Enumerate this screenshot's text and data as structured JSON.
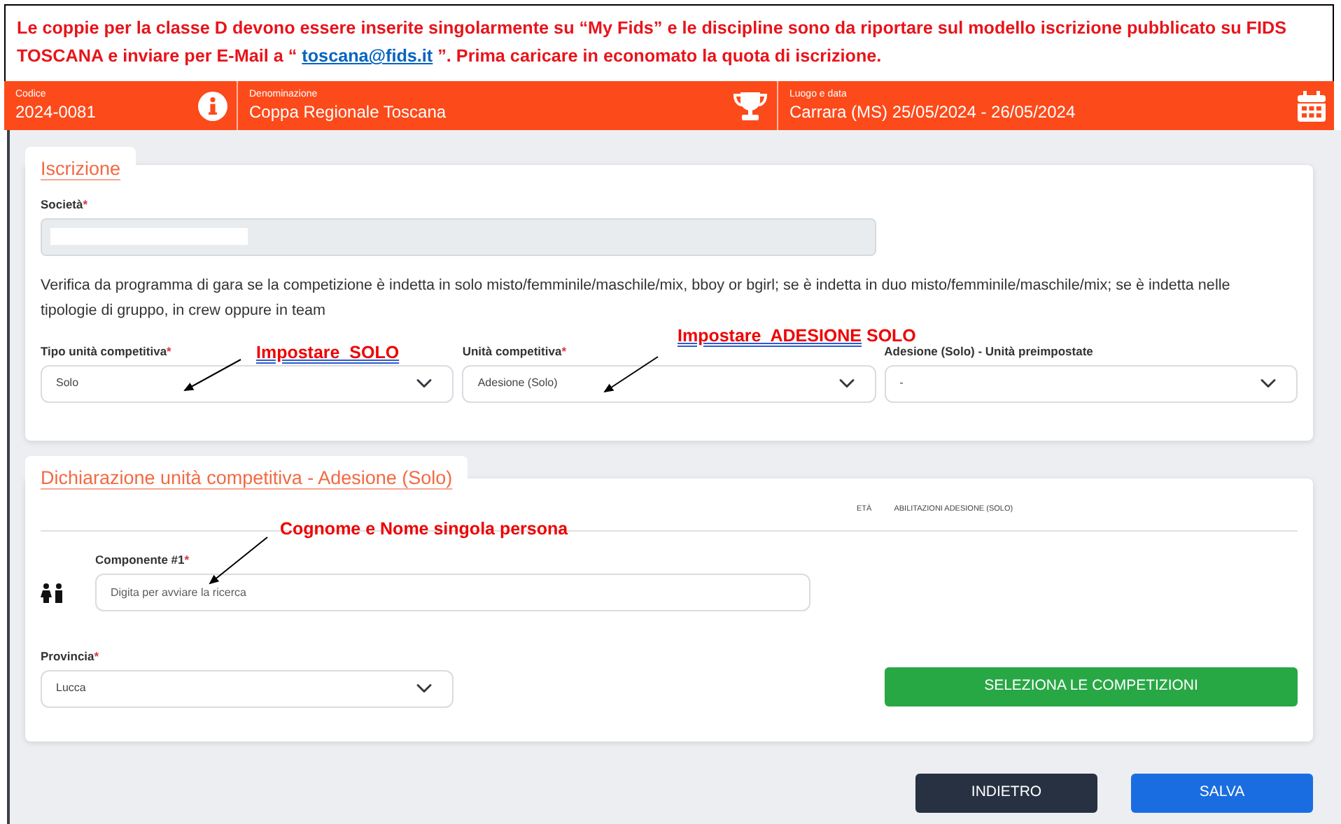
{
  "note": {
    "text_before": "Le coppie per la classe D devono essere inserite singolarmente su “My Fids” e le discipline sono da riportare sul modello iscrizione pubblicato su FIDS TOSCANA e inviare per E-Mail a “ ",
    "link": "toscana@fids.it",
    "text_after": " ”. Prima caricare in economato la quota di iscrizione."
  },
  "header": [
    {
      "label": "Codice",
      "value": "2024-0081"
    },
    {
      "label": "Denominazione",
      "value": "Coppa Regionale Toscana"
    },
    {
      "label": "Luogo e data",
      "value": "Carrara (MS) 25/05/2024 - 26/05/2024"
    }
  ],
  "iscrizione": {
    "title": "Iscrizione",
    "societa": {
      "label": "Società",
      "marker": "*"
    },
    "help": "Verifica da programma di gara se la competizione è indetta in solo misto/femminile/maschile/mix, bboy or bgirl; se è indetta in duo misto/femminile/maschile/mix; se è indetta nelle tipologie di gruppo, in crew oppure in team",
    "selects": [
      {
        "label": "Tipo unità competitiva",
        "marker": "*",
        "value": "Solo"
      },
      {
        "label": "Unità competitiva",
        "marker": "*",
        "value": "Adesione (Solo)"
      },
      {
        "label": "Adesione (Solo) - Unità preimpostate",
        "value": "-"
      }
    ]
  },
  "dichiarazione": {
    "title": "Dichiarazione unità competitiva - Adesione (Solo)",
    "columns": [
      "ETÀ",
      "ABILITAZIONI ADESIONE (SOLO)"
    ],
    "componente": {
      "label": "Componente #1",
      "marker": "*",
      "placeholder": "Digita per avviare la ricerca"
    },
    "provincia": {
      "label": "Provincia",
      "marker": "*",
      "value": "Lucca"
    },
    "select_button": "SELEZIONA LE COMPETIZIONI"
  },
  "buttons": [
    {
      "label": "INDIETRO",
      "kind": "back"
    },
    {
      "label": "SALVA",
      "kind": "save"
    }
  ],
  "annotations": [
    {
      "underlined": "Impostare  SOLO"
    },
    {
      "underlined": "Impostare  ADESIONE",
      "rest": " SOLO"
    },
    {
      "rest": "Cognome e Nome singola persona"
    }
  ]
}
